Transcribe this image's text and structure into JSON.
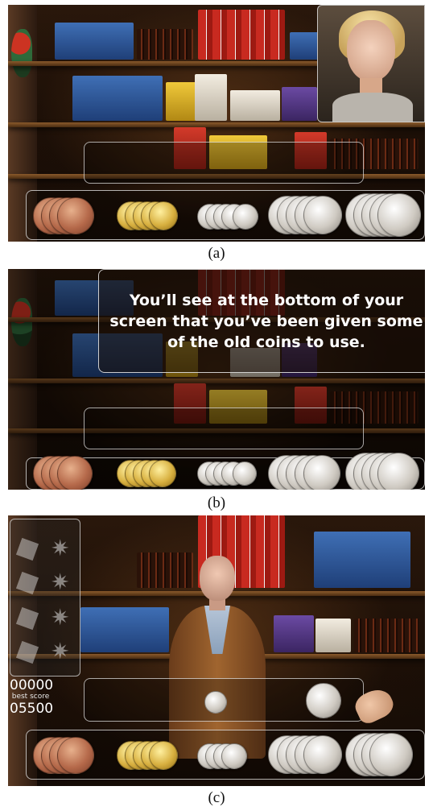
{
  "panels": [
    {
      "caption": "(a)",
      "portrait": "shopkeeper-woman",
      "coins": [
        "penny",
        "threepence",
        "sixpence",
        "shilling",
        "half-crown"
      ]
    },
    {
      "caption": "(b)",
      "speech": "You’ll see at the bottom of your screen that you’ve been given some of the old coins to use.",
      "coins": [
        "penny",
        "threepence",
        "sixpence",
        "shilling",
        "half-crown"
      ]
    },
    {
      "caption": "(c)",
      "score": "00000",
      "best_score_label": "best score",
      "best_score": "05500",
      "character": "shopkeeper-man",
      "coins": [
        "penny",
        "threepence",
        "sixpence",
        "shilling",
        "half-crown"
      ]
    }
  ],
  "colors": {
    "frame_border": "#ebebeb",
    "copper": "#b5694a",
    "gold": "#d8b040",
    "silver": "#cfcac2"
  }
}
